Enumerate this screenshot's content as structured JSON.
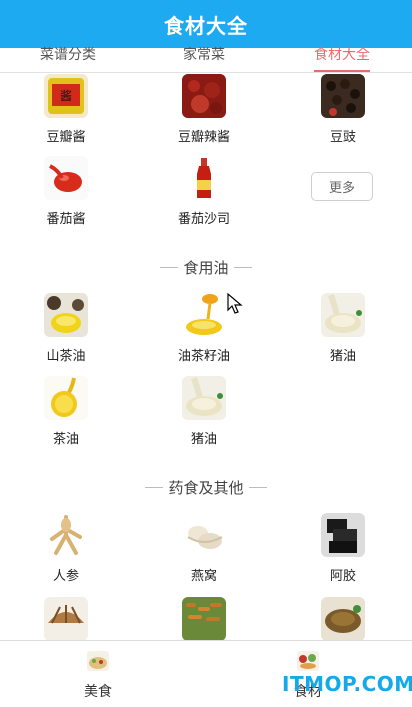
{
  "header": {
    "title": "食材大全"
  },
  "tabs": [
    {
      "label": "菜谱分类",
      "active": false
    },
    {
      "label": "家常菜",
      "active": false
    },
    {
      "label": "食材大全",
      "active": true
    }
  ],
  "top_items": [
    {
      "label": "豆瓣酱",
      "icon": "doubanjiang-jar-icon"
    },
    {
      "label": "豆瓣辣酱",
      "icon": "chili-paste-icon"
    },
    {
      "label": "豆豉",
      "icon": "fermented-beans-icon"
    },
    {
      "label": "番茄酱",
      "icon": "ketchup-icon"
    },
    {
      "label": "番茄沙司",
      "icon": "tomato-sauce-bottle-icon"
    }
  ],
  "more_label": "更多",
  "sections": [
    {
      "title": "食用油",
      "items": [
        {
          "label": "山茶油",
          "icon": "camellia-oil-icon"
        },
        {
          "label": "油茶籽油",
          "icon": "tea-seed-oil-icon"
        },
        {
          "label": "猪油",
          "icon": "lard-icon"
        },
        {
          "label": "茶油",
          "icon": "tea-oil-icon"
        },
        {
          "label": "猪油",
          "icon": "lard-icon"
        }
      ]
    },
    {
      "title": "药食及其他",
      "items": [
        {
          "label": "人参",
          "icon": "ginseng-icon"
        },
        {
          "label": "燕窝",
          "icon": "birds-nest-icon"
        },
        {
          "label": "阿胶",
          "icon": "donkey-hide-gelatin-icon"
        },
        {
          "label": "",
          "icon": "dried-mushroom-icon"
        },
        {
          "label": "",
          "icon": "cordyceps-icon"
        },
        {
          "label": "",
          "icon": "lingzhi-icon"
        }
      ]
    }
  ],
  "bottom_nav": [
    {
      "label": "美食",
      "icon": "food-icon"
    },
    {
      "label": "食材",
      "icon": "ingredients-icon"
    }
  ],
  "watermark": "ITMOP.COM",
  "colors": {
    "header": "#1eaaf0",
    "active_tab": "#e86b6b",
    "watermark": "#14a9e8"
  }
}
